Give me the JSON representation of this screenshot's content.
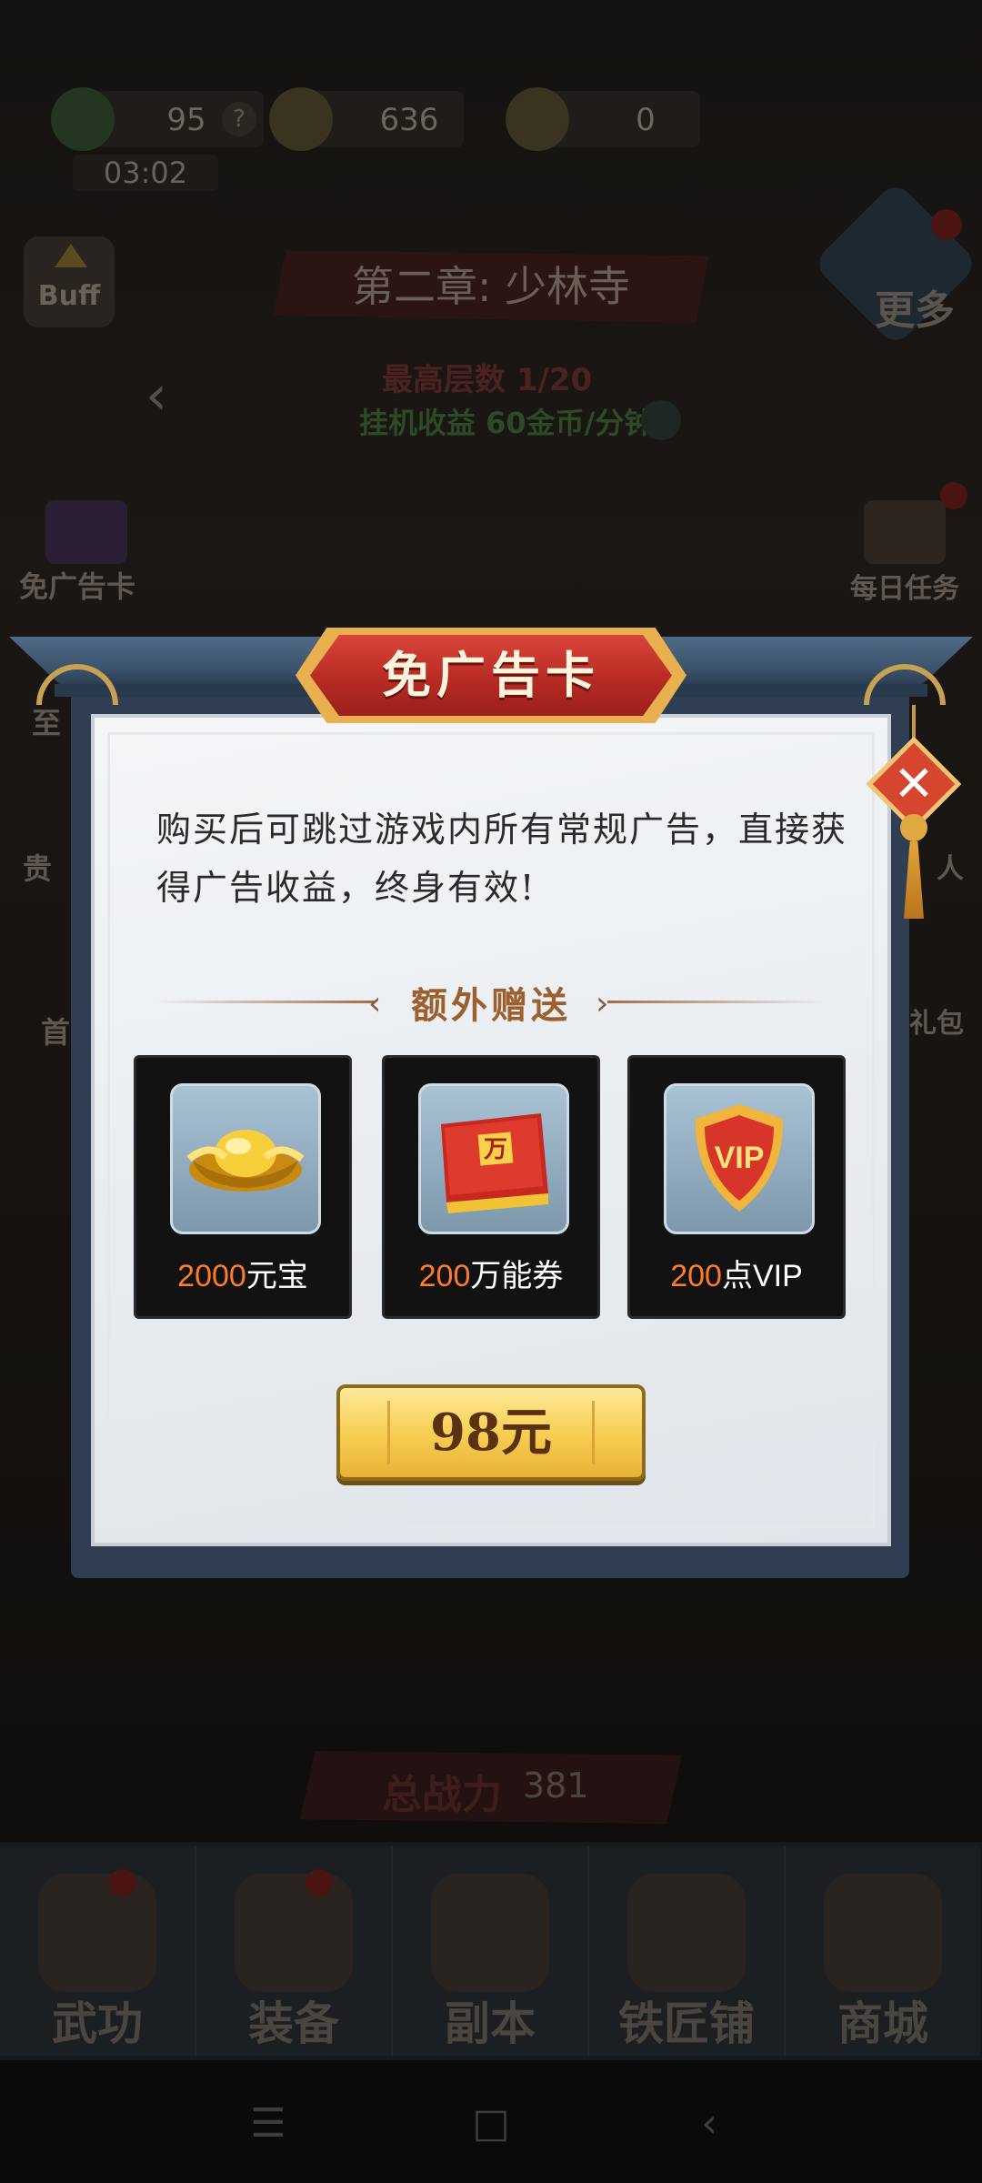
{
  "background": {
    "resources": [
      {
        "name": "stamina",
        "value": "95",
        "icon": "green-flag-icon",
        "color": "#2f5a24"
      },
      {
        "name": "coins",
        "value": "636",
        "icon": "coin-icon",
        "color": "#6a5a2a"
      },
      {
        "name": "ingots",
        "value": "0",
        "icon": "gold-ingot-icon",
        "color": "#6a5a2a"
      }
    ],
    "help_glyph": "?",
    "timer": "03:02",
    "buff_label": "Buff",
    "chapter_title": "第二章: 少林寺",
    "more_label": "更多",
    "floor_text": "最高层数 1/20",
    "earn_text": "挂机收益 60金币/分钟",
    "nav_left": "‹",
    "left_side": [
      {
        "label": "免广告卡"
      },
      {
        "label": "至"
      },
      {
        "label": "贵"
      },
      {
        "label": "首"
      }
    ],
    "right_side": [
      {
        "label": "每日任务"
      },
      {
        "label": "人"
      },
      {
        "label": "礼包"
      }
    ],
    "power_label": "总战力",
    "power_value": "381",
    "tabs": [
      {
        "label": "武功"
      },
      {
        "label": "装备"
      },
      {
        "label": "副本"
      },
      {
        "label": "铁匠铺"
      },
      {
        "label": "商城"
      }
    ],
    "system_nav": [
      "☰",
      "□",
      "‹"
    ]
  },
  "modal": {
    "title": "免广告卡",
    "close_glyph": "✕",
    "description": "购买后可跳过游戏内所有常规广告，直接获得广告收益，终身有效!",
    "extra_title": "额外赠送",
    "chevron_left": "‹",
    "chevron_right": "›",
    "rewards": [
      {
        "amount": "2000",
        "unit": "元宝",
        "icon": "gold-ingot-icon"
      },
      {
        "amount": "200",
        "unit": "万能券",
        "icon": "red-voucher-icon"
      },
      {
        "amount": "200",
        "unit": "点VIP",
        "icon": "vip-shield-icon"
      }
    ],
    "price_label": "98元"
  },
  "colors": {
    "accent_red": "#b82b25",
    "gold": "#f7cf55",
    "reward_number": "#ff7a2a"
  }
}
